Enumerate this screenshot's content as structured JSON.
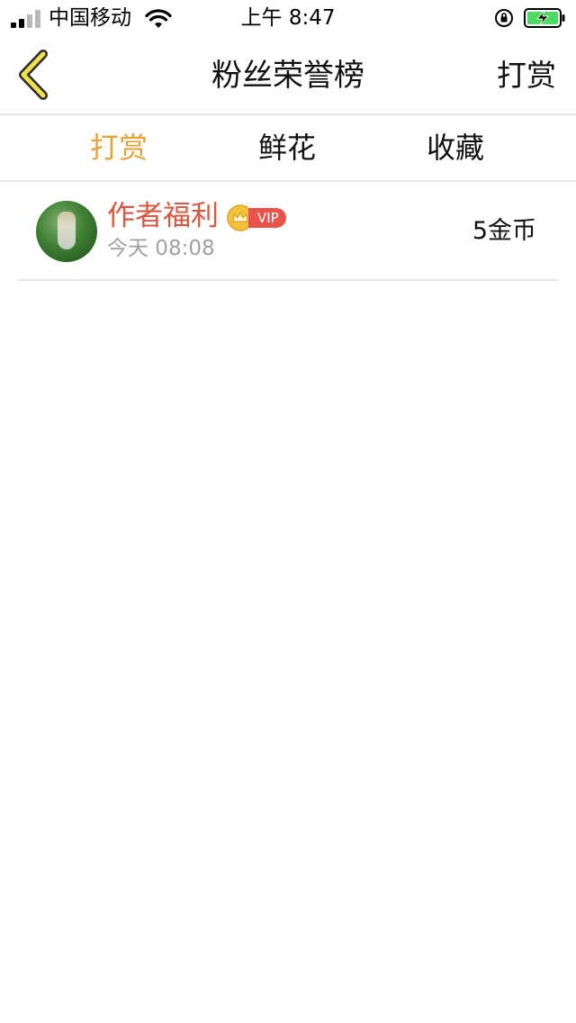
{
  "status_bar": {
    "carrier": "中国移动",
    "time": "上午 8:47",
    "icons": [
      "signal-icon",
      "wifi-icon",
      "rotation-lock-icon",
      "battery-charging-icon"
    ]
  },
  "nav": {
    "title": "粉丝荣誉榜",
    "right_action": "打赏",
    "back_icon": "chevron-left-icon",
    "back_icon_color": "#f2e04a"
  },
  "tabs": [
    {
      "label": "打赏",
      "active": true
    },
    {
      "label": "鲜花",
      "active": false
    },
    {
      "label": "收藏",
      "active": false
    }
  ],
  "colors": {
    "active_tab": "#e8a33a",
    "username": "#d9573f",
    "vip_badge": "#e8534b",
    "crown": "#f4c23a",
    "secondary_text": "#a0a0a0",
    "divider": "#e6e6e6"
  },
  "list": [
    {
      "name": "作者福利",
      "badge": "VIP",
      "time": "今天 08:08",
      "amount": "5金币"
    }
  ]
}
